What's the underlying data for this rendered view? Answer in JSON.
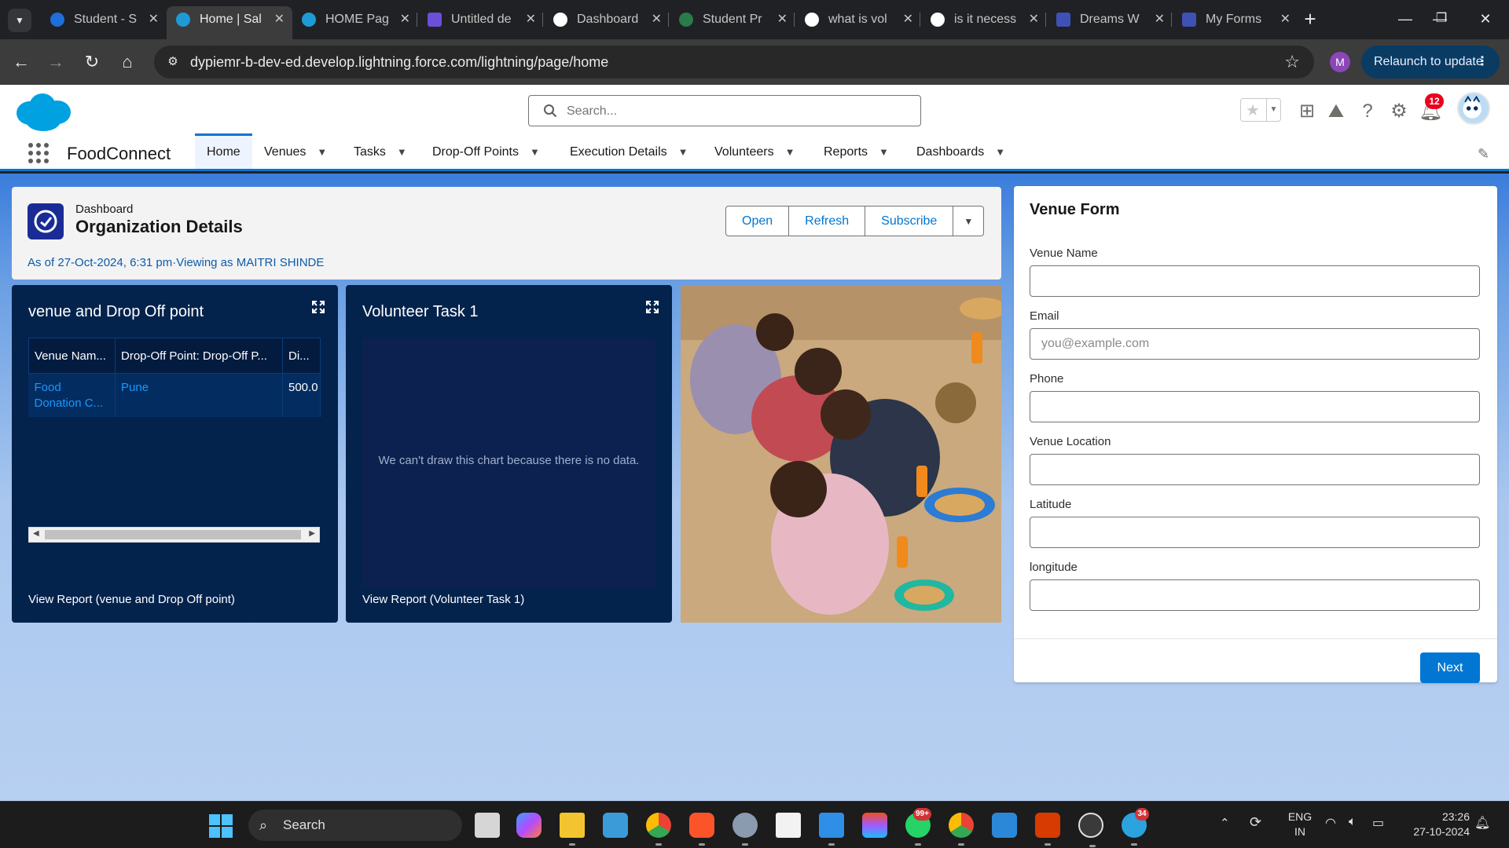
{
  "browser": {
    "tabs": [
      {
        "title": "Student - S",
        "color": "#1e6fd9",
        "active": false
      },
      {
        "title": "Home | Sal",
        "color": "#1e9bd7",
        "active": true
      },
      {
        "title": "HOME Pag",
        "color": "#1e9bd7",
        "active": false
      },
      {
        "title": "Untitled de",
        "color": "#6b4fd8",
        "active": false
      },
      {
        "title": "Dashboard",
        "color": "#2d5fb8",
        "active": false
      },
      {
        "title": "Student Pr",
        "color": "#2a7a4b",
        "active": false
      },
      {
        "title": "what is vol",
        "color": "#ffffff",
        "active": false
      },
      {
        "title": "is it necess",
        "color": "#ffffff",
        "active": false
      },
      {
        "title": "Dreams W",
        "color": "#3f51b5",
        "active": false
      },
      {
        "title": "My Forms",
        "color": "#3f51b5",
        "active": false
      }
    ],
    "url": "dypiemr-b-dev-ed.develop.lightning.force.com/lightning/page/home",
    "profile_initial": "M",
    "relaunch_label": "Relaunch to update"
  },
  "header": {
    "search_placeholder": "Search...",
    "notification_count": "12"
  },
  "nav": {
    "app_name": "FoodConnect",
    "items": [
      {
        "label": "Home",
        "active": true
      },
      {
        "label": "Venues"
      },
      {
        "label": "Tasks"
      },
      {
        "label": "Drop-Off Points"
      },
      {
        "label": "Execution Details"
      },
      {
        "label": "Volunteers"
      },
      {
        "label": "Reports"
      },
      {
        "label": "Dashboards"
      }
    ]
  },
  "dashboard": {
    "eyebrow": "Dashboard",
    "title": "Organization Details",
    "meta": "As of 27-Oct-2024, 6:31 pm·Viewing as MAITRI SHINDE",
    "buttons": {
      "open": "Open",
      "refresh": "Refresh",
      "subscribe": "Subscribe"
    }
  },
  "widget1": {
    "title": "venue and Drop Off point",
    "columns": [
      "Venue Nam...",
      "Drop-Off Point: Drop-Off P...",
      "Di..."
    ],
    "row": {
      "venue": "Food Donation C...",
      "dropoff": "Pune",
      "distance": "500.0"
    },
    "footer": "View Report (venue and Drop Off point)"
  },
  "widget2": {
    "title": "Volunteer Task 1",
    "empty_message": "We can't draw this chart because there is no data.",
    "footer": "View Report (Volunteer Task 1)"
  },
  "venue_form": {
    "title": "Venue Form",
    "fields": [
      {
        "label": "Venue Name",
        "value": "",
        "placeholder": ""
      },
      {
        "label": "Email",
        "value": "",
        "placeholder": "you@example.com"
      },
      {
        "label": "Phone",
        "value": "",
        "placeholder": ""
      },
      {
        "label": "Venue Location",
        "value": "",
        "placeholder": ""
      },
      {
        "label": "Latitude",
        "value": "",
        "placeholder": ""
      },
      {
        "label": "longitude",
        "value": "",
        "placeholder": ""
      }
    ],
    "next_label": "Next"
  },
  "taskbar": {
    "search_label": "Search",
    "whatsapp_badge": "99+",
    "telegram_badge": "34",
    "lang_primary": "ENG",
    "lang_secondary": "IN",
    "time": "23:26",
    "date": "27-10-2024"
  },
  "colors": {
    "accent": "#0176d3",
    "widget_bg": "#03234d",
    "link": "#1b96ff"
  }
}
